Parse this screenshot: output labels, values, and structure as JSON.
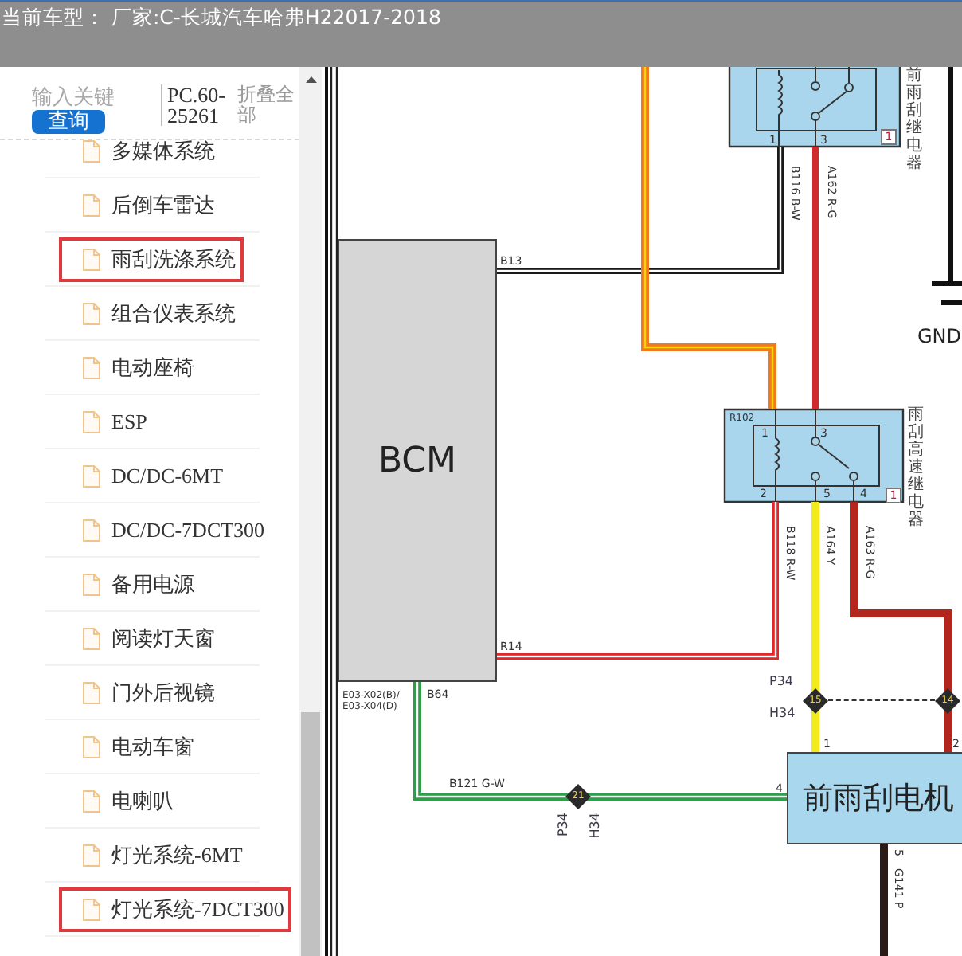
{
  "title": "当前车型： 厂家:C-长城汽车哈弗H22017-2018",
  "sidebar": {
    "search": {
      "placeholder": "输入关键",
      "button": "查询"
    },
    "code_field": {
      "value": "PC.60-25261"
    },
    "collapse_link": "折叠全部",
    "items": [
      {
        "label": "多媒体系统",
        "highlighted": false
      },
      {
        "label": "后倒车雷达",
        "highlighted": false
      },
      {
        "label": "雨刮洗涤系统",
        "highlighted": true
      },
      {
        "label": "组合仪表系统",
        "highlighted": false
      },
      {
        "label": "电动座椅",
        "highlighted": false
      },
      {
        "label": "ESP",
        "highlighted": false
      },
      {
        "label": "DC/DC-6MT",
        "highlighted": false
      },
      {
        "label": "DC/DC-7DCT300",
        "highlighted": false
      },
      {
        "label": "备用电源",
        "highlighted": false
      },
      {
        "label": "阅读灯天窗",
        "highlighted": false
      },
      {
        "label": "门外后视镜",
        "highlighted": false
      },
      {
        "label": "电动车窗",
        "highlighted": false
      },
      {
        "label": "电喇叭",
        "highlighted": false
      },
      {
        "label": "灯光系统-6MT",
        "highlighted": false
      },
      {
        "label": "灯光系统-7DCT300",
        "highlighted": true
      }
    ]
  },
  "diagram": {
    "bcm": {
      "name": "BCM",
      "pins": [
        "B13",
        "R14",
        "B64"
      ],
      "connector": "E03-X02(B)/ E03-X04(D)"
    },
    "relays": [
      {
        "name": "前雨刮继电器",
        "pins": [
          "1",
          "3"
        ],
        "number": "1"
      },
      {
        "code": "R102",
        "name": "雨刮高速继电器",
        "pins": [
          "1",
          "3",
          "2",
          "5",
          "4"
        ],
        "number": "1"
      }
    ],
    "wires": [
      {
        "label": "B116 B-W",
        "color": "#1a1a1a",
        "striped": true
      },
      {
        "color": "#f07a1e",
        "striped": true
      },
      {
        "label": "A162 R-G",
        "color": "#d02a2a",
        "striped": false
      },
      {
        "label": "B118 R-W",
        "color": "#e3262a",
        "striped": true
      },
      {
        "label": "A164 Y",
        "color": "#f2ea1a",
        "striped": false
      },
      {
        "label": "A163 R-G",
        "color": "#b3261e",
        "striped": false
      },
      {
        "label": "B121 G-W",
        "color": "#2e9e48",
        "striped": true
      },
      {
        "label": "G141 P",
        "color": "#2b1b17",
        "striped": false
      }
    ],
    "connectors": [
      {
        "number": "15",
        "labels": [
          "P34",
          "H34"
        ]
      },
      {
        "number": "14"
      },
      {
        "number": "21",
        "labels": [
          "P34",
          "H34"
        ]
      }
    ],
    "motor": {
      "name": "前雨刮电机",
      "pins": [
        "1",
        "2",
        "4",
        "5"
      ]
    },
    "ground": {
      "label": "GND"
    }
  }
}
